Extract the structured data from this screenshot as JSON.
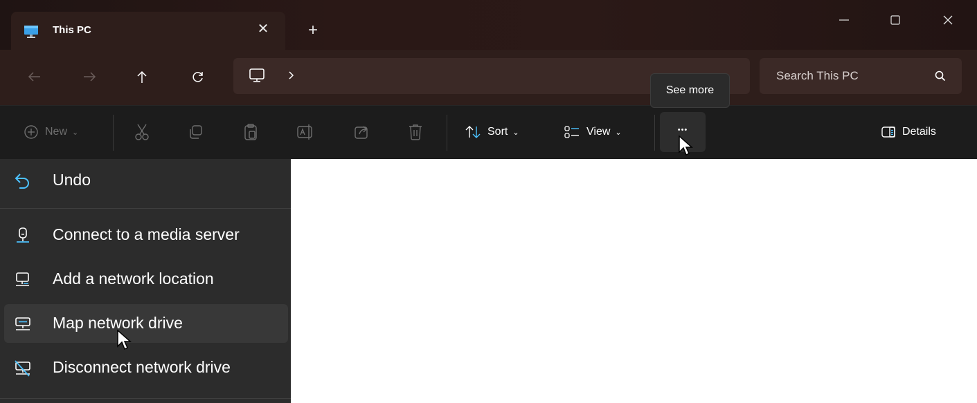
{
  "window": {
    "tab": {
      "title": "This PC",
      "close_glyph": "✕"
    },
    "new_tab_glyph": "+",
    "controls": {
      "minimize": "minimize-icon",
      "maximize": "maximize-icon",
      "close": "close-icon"
    }
  },
  "nav": {
    "back": "arrow-left-icon",
    "forward": "arrow-right-icon",
    "up": "arrow-up-icon",
    "refresh": "refresh-icon",
    "address": {
      "location_icon": "pc-icon",
      "separator_glyph": "›"
    },
    "search": {
      "placeholder": "Search This PC"
    }
  },
  "tooltip": {
    "text": "See more"
  },
  "commandbar": {
    "new_label": "New",
    "sort_label": "Sort",
    "view_label": "View",
    "more_glyph": "•••",
    "details_label": "Details",
    "chevron_glyph": "⌄",
    "disabled_icons": [
      "cut-icon",
      "copy-icon",
      "paste-icon",
      "rename-icon",
      "share-icon",
      "delete-icon"
    ]
  },
  "menu": {
    "items": [
      {
        "label": "Undo",
        "icon": "undo-icon"
      },
      {
        "label": "Connect to a media server",
        "icon": "media-server-icon"
      },
      {
        "label": "Add a network location",
        "icon": "network-location-icon"
      },
      {
        "label": "Map network drive",
        "icon": "map-drive-icon",
        "hovered": true
      },
      {
        "label": "Disconnect network drive",
        "icon": "disconnect-drive-icon"
      }
    ]
  },
  "colors": {
    "titlebar_bg": "#2a1816",
    "navrow_bg": "#2e1e1b",
    "commandbar_bg": "#1c1c1c",
    "menu_bg": "#2c2c2c",
    "accent": "#4cc2ff"
  }
}
